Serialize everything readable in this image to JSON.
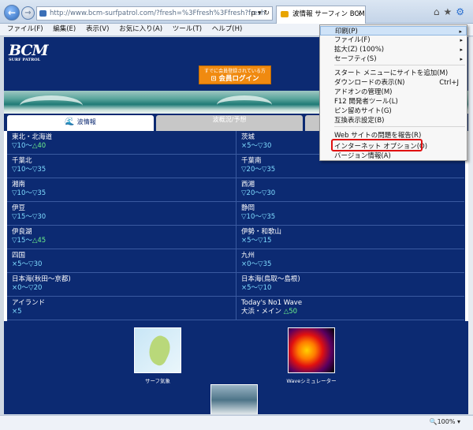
{
  "browser": {
    "back_glyph": "←",
    "forward_glyph": "→",
    "address": "http://www.bcm-surfpatrol.com/?fresh=%3Ffresh%3Ffresh?fresh",
    "address_tools": "ρ ▾ ↻",
    "tab_title": "波情報 サーフィン BCM",
    "tab_close": "×",
    "icon_home": "⌂",
    "icon_star": "★",
    "icon_gear": "⚙",
    "menubar": [
      "ファイル(F)",
      "編集(E)",
      "表示(V)",
      "お気に入り(A)",
      "ツール(T)",
      "ヘルプ(H)"
    ],
    "zoom": "🔍100% ▾"
  },
  "site": {
    "logo": "BCM",
    "logo_sub": "SURF PATROL",
    "login_small": "すでに会員登録されている方",
    "login_main": "⊡ 会員ログイン",
    "tab_active": "波情報",
    "tab_active_icon": "🌊",
    "tab_inactive": "波概況/予想"
  },
  "regions": [
    {
      "name": "東北・北海道",
      "val": "▽10〜",
      "val2": "△40",
      "cls": "g"
    },
    {
      "name": "茨城",
      "val": "×5〜",
      "val2": "▽30"
    },
    {
      "name": "千葉北",
      "val": "▽10〜▽35"
    },
    {
      "name": "千葉南",
      "val": "▽20〜▽35"
    },
    {
      "name": "湘南",
      "val": "▽10〜▽35"
    },
    {
      "name": "西湘",
      "val": "▽20〜▽30"
    },
    {
      "name": "伊豆",
      "val": "▽15〜▽30"
    },
    {
      "name": "静岡",
      "val": "▽10〜▽35"
    },
    {
      "name": "伊良湖",
      "val": "▽15〜",
      "val2": "△45",
      "cls": "g"
    },
    {
      "name": "伊勢・和歌山",
      "val": "×5〜▽15"
    },
    {
      "name": "四国",
      "val": "×5〜▽30"
    },
    {
      "name": "九州",
      "val": "×0〜▽35"
    },
    {
      "name": "日本海(秋田〜京都)",
      "val": "×0〜▽20"
    },
    {
      "name": "日本海(鳥取〜島根)",
      "val": "×5〜▽10"
    },
    {
      "name": "アイランド",
      "val": "×5"
    },
    {
      "name": "Today's No1 Wave",
      "val": "大浜・メイン",
      "val2": "△50",
      "cls": "g"
    }
  ],
  "thumbs": {
    "left_label": "サーフ気象",
    "right_label": "Waveシミュレーター"
  },
  "tools_menu": {
    "items": [
      {
        "label": "印刷(P)",
        "arrow": "▸",
        "hl": true
      },
      {
        "label": "ファイル(F)",
        "arrow": "▸"
      },
      {
        "label": "拡大(Z) (100%)",
        "arrow": "▸"
      },
      {
        "label": "セーフティ(S)",
        "arrow": "▸"
      },
      {
        "label": "スタート メニューにサイトを追加(M)"
      },
      {
        "label": "ダウンロードの表示(N)",
        "shortcut": "Ctrl+J"
      },
      {
        "label": "アドオンの管理(M)"
      },
      {
        "label": "F12 開発者ツール(L)"
      },
      {
        "label": "ピン留めサイト(G)"
      },
      {
        "label": "互換表示設定(B)"
      },
      {
        "label": "Web サイトの問題を報告(R)"
      },
      {
        "label": "インターネット オプション(O)"
      },
      {
        "label": "バージョン情報(A)"
      }
    ]
  }
}
